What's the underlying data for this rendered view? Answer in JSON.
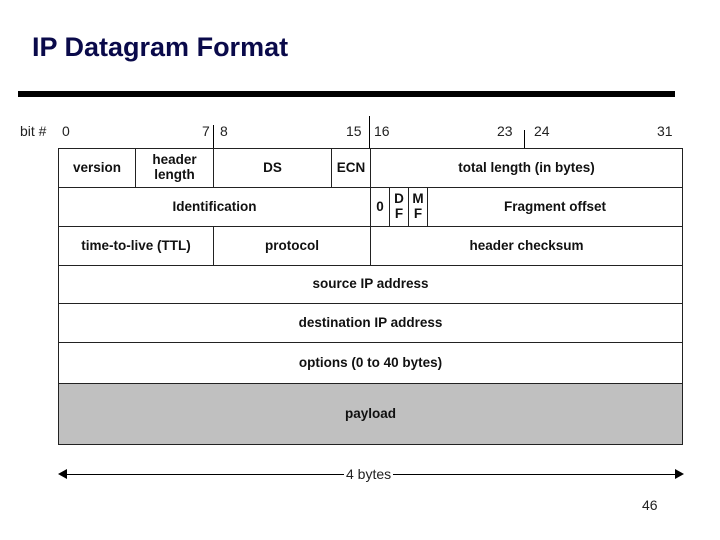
{
  "title": "IP Datagram Format",
  "bit_labels": {
    "prefix": "bit #",
    "b0": "0",
    "b7": "7",
    "b8": "8",
    "b15": "15",
    "b16": "16",
    "b23": "23",
    "b24": "24",
    "b31": "31"
  },
  "fields": {
    "version": "version",
    "header_length": "header length",
    "ds": "DS",
    "ecn": "ECN",
    "total_length": "total length (in bytes)",
    "identification": "Identification",
    "flag_zero": "0",
    "df": "D F",
    "mf": "M F",
    "fragment_offset": "Fragment offset",
    "ttl": "time-to-live (TTL)",
    "protocol": "protocol",
    "header_checksum": "header checksum",
    "source_ip": "source IP address",
    "destination_ip": "destination IP address",
    "options": "options (0 to 40 bytes)",
    "payload": "payload"
  },
  "width_label": "4 bytes",
  "page_number": "46",
  "colors": {
    "title": "#0a0a4a",
    "payload_fill": "#c0c0c0"
  }
}
